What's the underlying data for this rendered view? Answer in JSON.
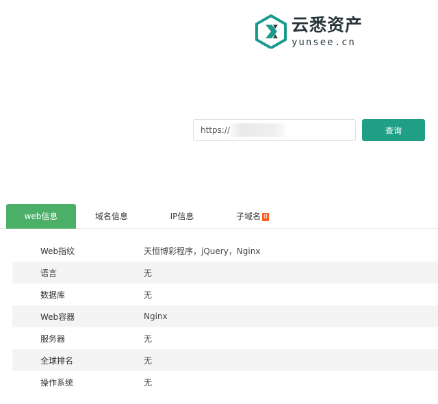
{
  "logo": {
    "name_cn": "云悉资产",
    "name_en": "yunsee.cn"
  },
  "search": {
    "value": "https://",
    "button_label": "查询"
  },
  "tabs": [
    {
      "label": "web信息",
      "active": true
    },
    {
      "label": "域名信息",
      "active": false
    },
    {
      "label": "IP信息",
      "active": false
    },
    {
      "label": "子域名",
      "active": false,
      "badge": "0"
    }
  ],
  "info_rows": [
    {
      "key": "Web指纹",
      "value": "天恒博彩程序，jQuery，Nginx"
    },
    {
      "key": "语言",
      "value": "无"
    },
    {
      "key": "数据库",
      "value": "无"
    },
    {
      "key": "Web容器",
      "value": "Nginx"
    },
    {
      "key": "服务器",
      "value": "无"
    },
    {
      "key": "全球排名",
      "value": "无"
    },
    {
      "key": "操作系统",
      "value": "无"
    }
  ],
  "colors": {
    "accent": "#1fa086",
    "tab_active": "#4caf67",
    "badge": "#ff5a1f",
    "logo_mark": "#1c9a8c"
  }
}
